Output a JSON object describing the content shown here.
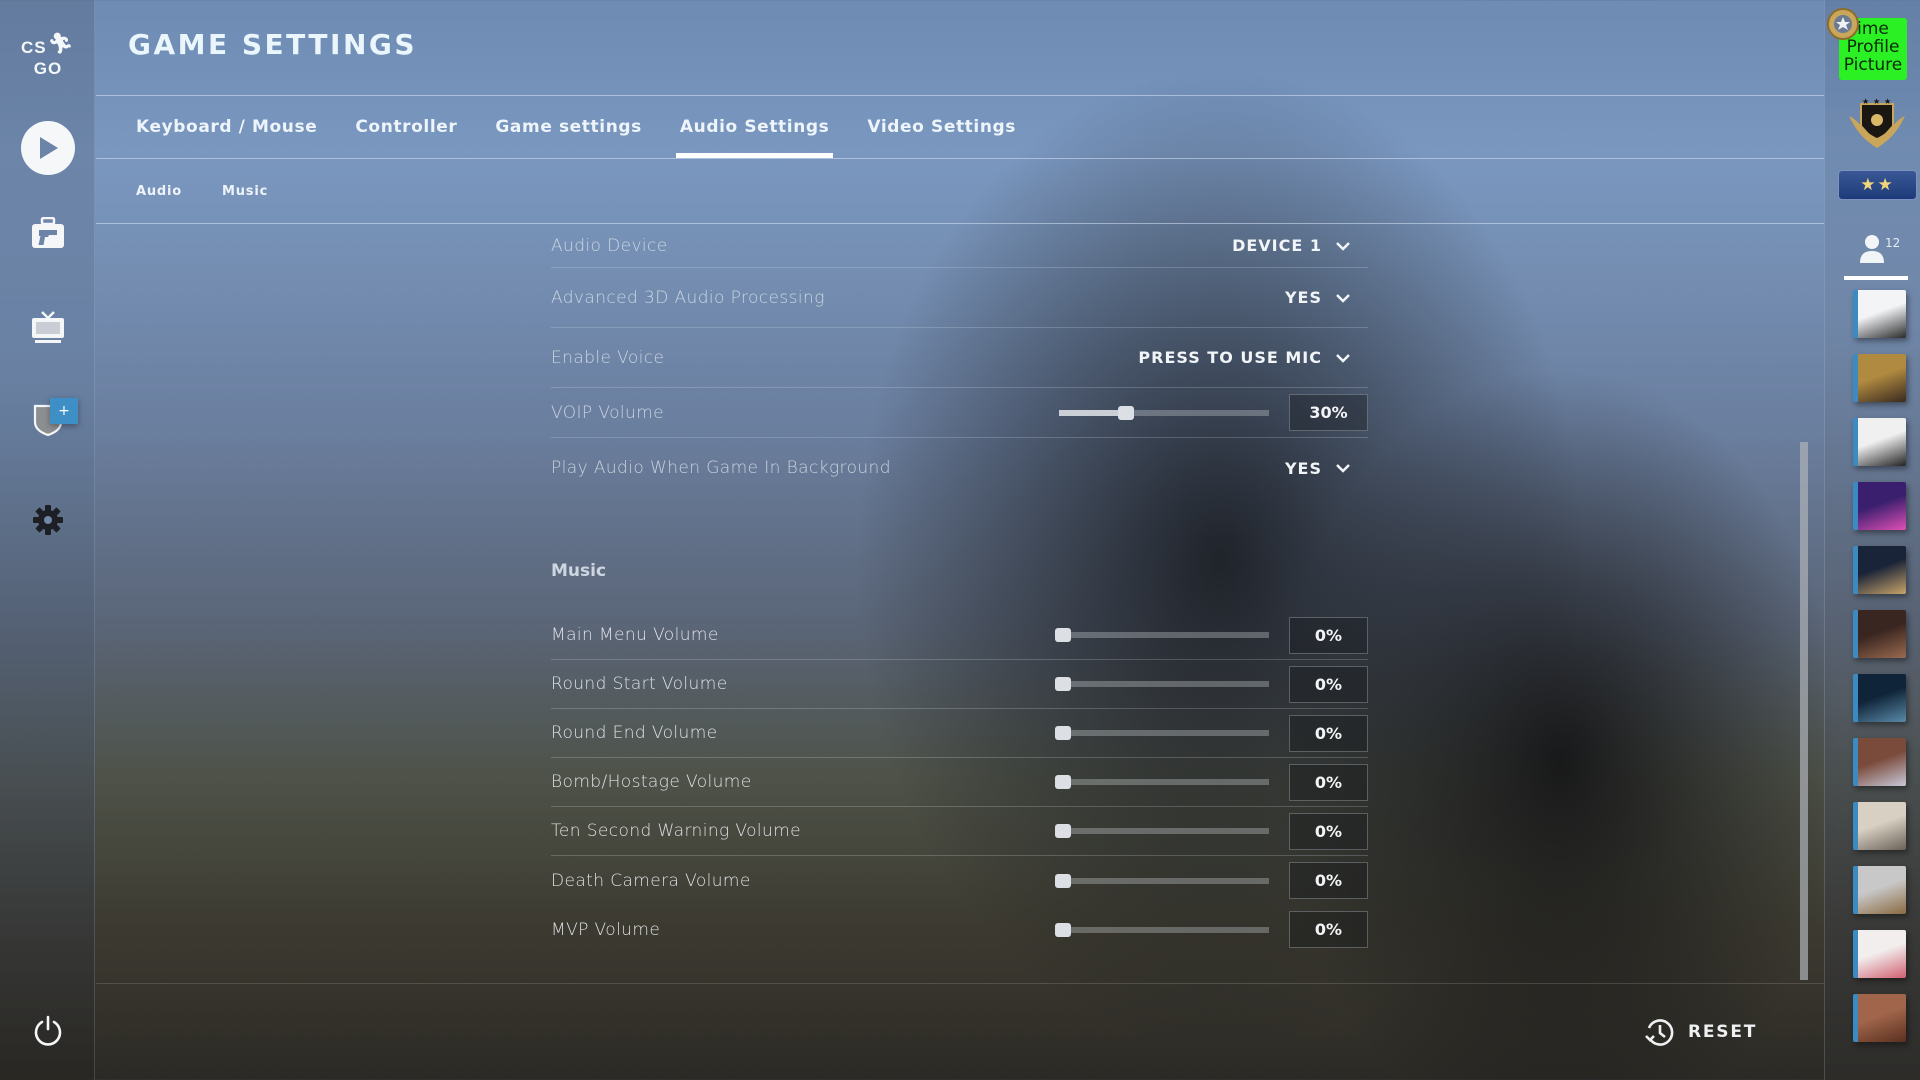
{
  "app": {
    "logo_text_left": "CS",
    "logo_text_right": "GO",
    "page_title": "GAME SETTINGS"
  },
  "sidebar": {
    "items": [
      {
        "name": "play",
        "icon": "play-icon"
      },
      {
        "name": "inventory",
        "icon": "briefcase-pistol-icon"
      },
      {
        "name": "watch",
        "icon": "tv-icon"
      },
      {
        "name": "pass",
        "icon": "shield-icon",
        "badge": "+"
      },
      {
        "name": "settings",
        "icon": "gear-icon"
      }
    ],
    "power_icon": "power-icon"
  },
  "tabs": [
    {
      "label": "Keyboard / Mouse",
      "active": false
    },
    {
      "label": "Controller",
      "active": false
    },
    {
      "label": "Game settings",
      "active": false
    },
    {
      "label": "Audio Settings",
      "active": true
    },
    {
      "label": "Video Settings",
      "active": false
    }
  ],
  "subtabs": [
    {
      "label": "Audio"
    },
    {
      "label": "Music"
    }
  ],
  "audio": {
    "rows": [
      {
        "label": "Audio Device",
        "type": "dropdown",
        "value": "DEVICE 1"
      },
      {
        "label": "Advanced 3D Audio Processing",
        "type": "dropdown",
        "value": "YES"
      },
      {
        "label": "Enable Voice",
        "type": "dropdown",
        "value": "PRESS TO USE MIC"
      },
      {
        "label": "VOIP Volume",
        "type": "slider",
        "value_text": "30%",
        "fraction": 0.3
      },
      {
        "label": "Play Audio When Game In Background",
        "type": "dropdown",
        "value": "YES"
      }
    ]
  },
  "music": {
    "heading": "Music",
    "rows": [
      {
        "label": "Main Menu Volume",
        "value_text": "0%",
        "fraction": 0
      },
      {
        "label": "Round Start Volume",
        "value_text": "0%",
        "fraction": 0
      },
      {
        "label": "Round End Volume",
        "value_text": "0%",
        "fraction": 0
      },
      {
        "label": "Bomb/Hostage Volume",
        "value_text": "0%",
        "fraction": 0
      },
      {
        "label": "Ten Second Warning Volume",
        "value_text": "0%",
        "fraction": 0
      },
      {
        "label": "Death Camera Volume",
        "value_text": "0%",
        "fraction": 0
      },
      {
        "label": "MVP Volume",
        "value_text": "0%",
        "fraction": 0
      }
    ]
  },
  "footer": {
    "reset_label": "RESET",
    "reset_icon": "history-reset-icon"
  },
  "rail": {
    "profile_picture_text": "ime Profile Picture",
    "profile_picture_color": "#2bf023",
    "rank_stars": "★★",
    "friends_count": "12",
    "friend_avatars": [
      {
        "desc": "jollypenguin",
        "colors": [
          "#f2f4f6",
          "#2a2a2a"
        ]
      },
      {
        "desc": "dog with cap",
        "colors": [
          "#b08a40",
          "#3a2a20"
        ]
      },
      {
        "desc": "anime sketch",
        "colors": [
          "#f0f0f0",
          "#222222"
        ]
      },
      {
        "desc": "neon retro",
        "colors": [
          "#3a1f6e",
          "#e14fb5"
        ]
      },
      {
        "desc": "blonde woman",
        "colors": [
          "#1a2438",
          "#c9a46a"
        ]
      },
      {
        "desc": "man with sunglasses",
        "colors": [
          "#3a2620",
          "#9a6a50"
        ]
      },
      {
        "desc": "astronaut",
        "colors": [
          "#0f2438",
          "#5a8aa8"
        ]
      },
      {
        "desc": "saluting man flag",
        "colors": [
          "#7a4a3a",
          "#c8c8d8"
        ]
      },
      {
        "desc": "map sketch",
        "colors": [
          "#d8d0c2",
          "#6a6258"
        ]
      },
      {
        "desc": "monkey toilet",
        "colors": [
          "#c8c8c8",
          "#8a6a40"
        ]
      },
      {
        "desc": "pink hair anime",
        "colors": [
          "#f2eeee",
          "#d06070"
        ]
      },
      {
        "desc": "sepia sunglasses",
        "colors": [
          "#a0654a",
          "#5a3020"
        ]
      }
    ]
  }
}
